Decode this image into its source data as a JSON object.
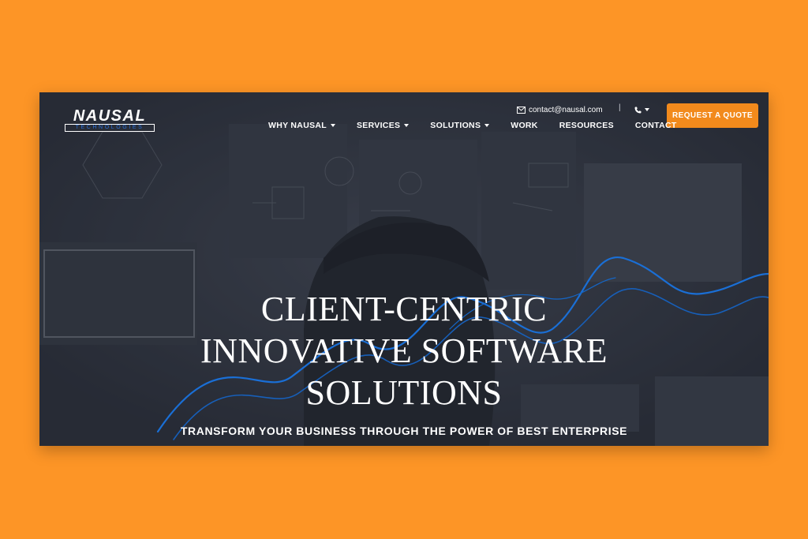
{
  "brand": {
    "name": "NAUSAL",
    "subtitle": "TECHNOLOGIES"
  },
  "topbar": {
    "email": "contact@nausal.com",
    "divider": "|"
  },
  "cta": {
    "label": "REQUEST A QUOTE"
  },
  "nav": {
    "items": [
      {
        "label": "WHY NAUSAL",
        "icon": "chevron-down-icon"
      },
      {
        "label": "SERVICES",
        "icon": "chevron-down-icon"
      },
      {
        "label": "SOLUTIONS",
        "icon": "chevron-down-icon"
      },
      {
        "label": "WORK"
      },
      {
        "label": "RESOURCES"
      },
      {
        "label": "CONTACT"
      }
    ]
  },
  "hero": {
    "lines": [
      "CLIENT-CENTRIC",
      "INNOVATIVE SOFTWARE",
      "SOLUTIONS"
    ],
    "tagline": "TRANSFORM YOUR BUSINESS THROUGH THE POWER OF BEST ENTERPRISE"
  },
  "colors": {
    "page_background": "#fd9526",
    "hero_overlay": "#2f3440",
    "accent_button": "#f28a1c",
    "wave_blue": "#1a6fd6",
    "logo_sub_blue": "#2a6fd8"
  }
}
